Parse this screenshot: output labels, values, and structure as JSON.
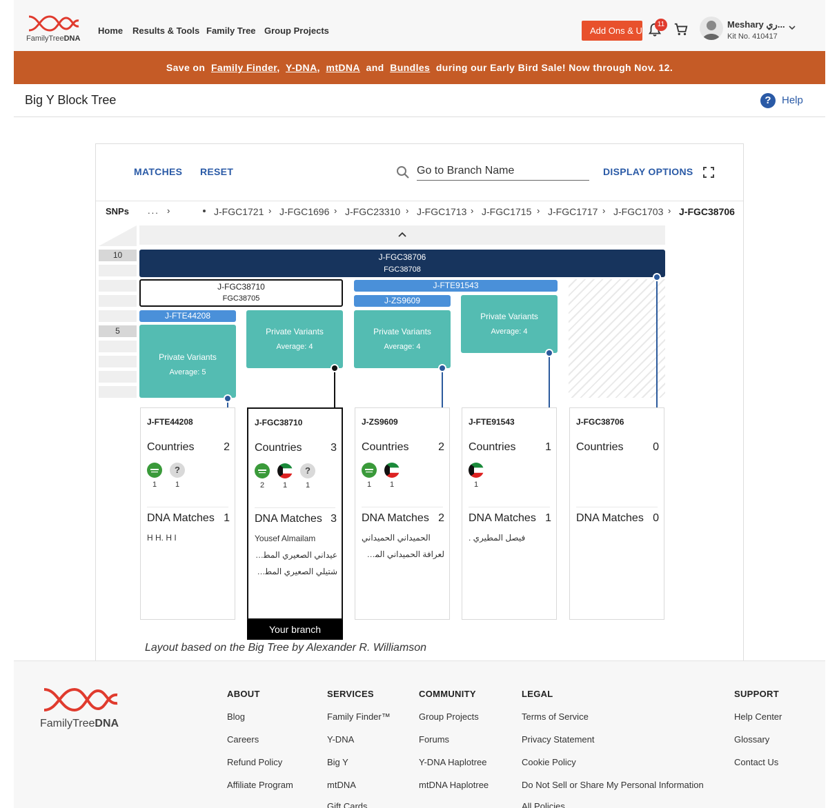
{
  "header": {
    "logo_text_light": "FamilyTree",
    "logo_text_bold": "DNA",
    "nav": [
      "Home",
      "Results & Tools",
      "Family Tree",
      "Group Projects"
    ],
    "addons_label": "Add Ons & Upgrades",
    "notification_count": "11",
    "user_name": "Meshary ري...",
    "kit_no": "Kit No. 410417"
  },
  "banner": {
    "prefix": "Save on",
    "link1": "Family Finder",
    "sep1": ",",
    "link2": "Y-DNA",
    "sep2": ",",
    "link3": "mtDNA",
    "and_text": "and",
    "link4": "Bundles",
    "suffix": "during our Early Bird Sale! Now through Nov. 12."
  },
  "page": {
    "title": "Big Y Block Tree",
    "help_label": "Help"
  },
  "toolbar": {
    "matches_label": "MATCHES",
    "reset_label": "RESET",
    "search_placeholder": "Go to Branch Name",
    "display_options_label": "DISPLAY OPTIONS"
  },
  "breadcrumb": {
    "label": "SNPs",
    "ellipsis": "...",
    "items": [
      "J-FGC1721",
      "J-FGC1696",
      "J-FGC23310",
      "J-FGC1713",
      "J-FGC1715",
      "J-FGC1717",
      "J-FGC1703",
      "J-FGC38706"
    ]
  },
  "scale": {
    "label_top": "10",
    "label_mid": "5"
  },
  "blocks": {
    "root": {
      "name": "J-FGC38706",
      "snp": "FGC38708"
    },
    "fgc38710": {
      "name": "J-FGC38710",
      "snp": "FGC38705"
    },
    "fte91543": {
      "name": "J-FTE91543"
    },
    "zs9609": {
      "name": "J-ZS9609"
    },
    "fte44208": {
      "name": "J-FTE44208"
    },
    "private_label": "Private Variants",
    "pv": [
      "Average: 5",
      "Average: 4",
      "Average: 4",
      "Average: 4"
    ]
  },
  "cards": [
    {
      "title": "J-FTE44208",
      "countries_label": "Countries",
      "countries_count": "2",
      "flag_counts": [
        "1",
        "1"
      ],
      "unknown_mark": "?",
      "dna_label": "DNA Matches",
      "dna_count": "1",
      "matches": [
        "H H. H I"
      ]
    },
    {
      "title": "J-FGC38710",
      "countries_label": "Countries",
      "countries_count": "3",
      "flag_counts": [
        "2",
        "1",
        "1"
      ],
      "unknown_mark": "?",
      "dna_label": "DNA Matches",
      "dna_count": "3",
      "matches": [
        "Yousef Almailam",
        "عيداني الصعيري المطيري .",
        "شتيلي الصعيري المطيري ."
      ]
    },
    {
      "title": "J-ZS9609",
      "countries_label": "Countries",
      "countries_count": "2",
      "flag_counts": [
        "1",
        "1"
      ],
      "dna_label": "DNA Matches",
      "dna_count": "2",
      "matches": [
        "الحميداني الحميداني",
        "لعرافة الحميداني المطيري ."
      ]
    },
    {
      "title": "J-FTE91543",
      "countries_label": "Countries",
      "countries_count": "1",
      "flag_counts": [
        "1"
      ],
      "dna_label": "DNA Matches",
      "dna_count": "1",
      "matches": [
        "فيصل المطيري ."
      ]
    },
    {
      "title": "J-FGC38706",
      "countries_label": "Countries",
      "countries_count": "0",
      "flag_counts": [],
      "dna_label": "DNA Matches",
      "dna_count": "0",
      "matches": []
    }
  ],
  "your_branch_label": "Your branch",
  "attribution": "Layout based on the Big Tree by Alexander R. Williamson",
  "footer": {
    "logo_text_light": "FamilyTree",
    "logo_text_bold": "DNA",
    "about": {
      "heading": "ABOUT",
      "links": [
        "Blog",
        "Careers",
        "Refund Policy",
        "Affiliate Program"
      ]
    },
    "services": {
      "heading": "SERVICES",
      "links": [
        "Family Finder™",
        "Y-DNA",
        "Big Y",
        "mtDNA",
        "Gift Cards"
      ]
    },
    "community": {
      "heading": "COMMUNITY",
      "links": [
        "Group Projects",
        "Forums",
        "Y-DNA Haplotree",
        "mtDNA Haplotree"
      ]
    },
    "legal": {
      "heading": "LEGAL",
      "links": [
        "Terms of Service",
        "Privacy Statement",
        "Cookie Policy",
        "Do Not Sell or Share My Personal Information",
        "All Policies"
      ]
    },
    "support": {
      "heading": "SUPPORT",
      "links": [
        "Help Center",
        "Glossary",
        "Contact Us"
      ]
    }
  },
  "colors": {
    "accent_orange": "#e8512c",
    "banner": "#c55b26",
    "root_block": "#17345d",
    "branch_blue": "#4a90d9",
    "private_teal": "#54bcb2",
    "link_blue": "#2a5aa6"
  }
}
